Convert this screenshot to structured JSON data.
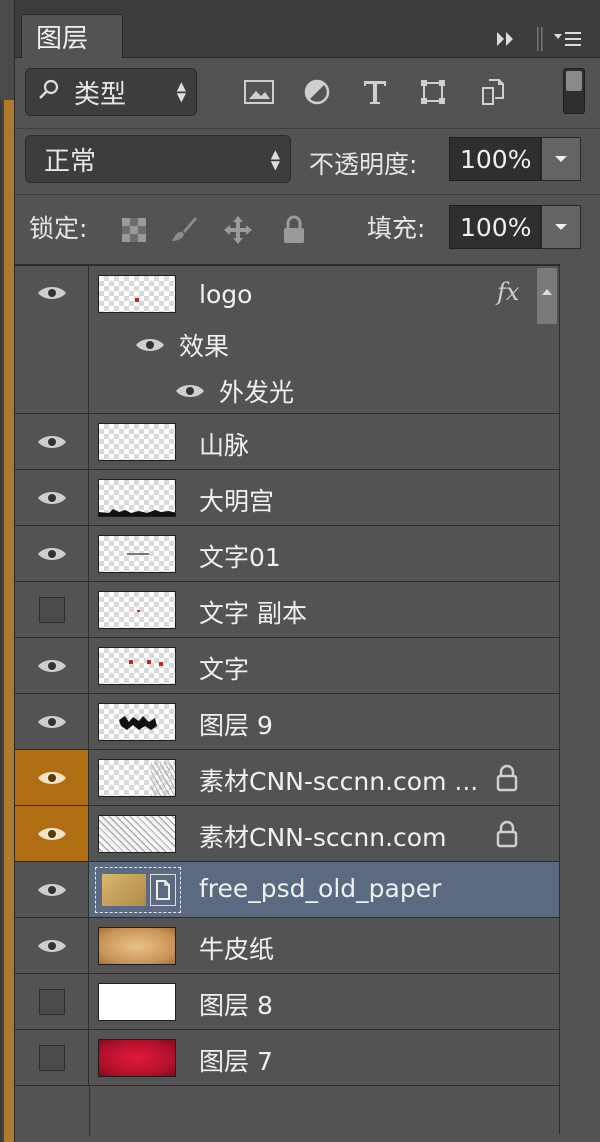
{
  "tab": {
    "title": "图层"
  },
  "filter": {
    "kind_label": "类型",
    "icons": [
      "image-filter-icon",
      "adjustment-filter-icon",
      "type-filter-icon",
      "shape-filter-icon",
      "smart-object-filter-icon"
    ]
  },
  "blend": {
    "mode": "正常",
    "opacity_label": "不透明度:",
    "opacity_value": "100%"
  },
  "lock": {
    "label": "锁定:",
    "fill_label": "填充:",
    "fill_value": "100%"
  },
  "layers": [
    {
      "name": "logo",
      "visible": true,
      "fx": "fx",
      "effects_label": "效果",
      "effect_item": "外发光"
    },
    {
      "name": "山脉",
      "visible": true
    },
    {
      "name": "大明宫",
      "visible": true
    },
    {
      "name": "文字01",
      "visible": true
    },
    {
      "name": "文字 副本",
      "visible": false
    },
    {
      "name": "文字",
      "visible": true
    },
    {
      "name": "图层 9",
      "visible": true
    },
    {
      "name": "素材CNN-sccnn.com ...",
      "visible": true,
      "locked": true,
      "highlight": "#b06e13"
    },
    {
      "name": "素材CNN-sccnn.com",
      "visible": true,
      "locked": true,
      "highlight": "#b06e13"
    },
    {
      "name": "free_psd_old_paper",
      "visible": true,
      "selected": true,
      "smart_object": true
    },
    {
      "name": "牛皮纸",
      "visible": true
    },
    {
      "name": "图层 8",
      "visible": false
    },
    {
      "name": "图层 7",
      "visible": false
    }
  ],
  "colors": {
    "panel_bg": "#535353",
    "selected_row": "#5b6a80",
    "orange_highlight": "#b06e13"
  }
}
